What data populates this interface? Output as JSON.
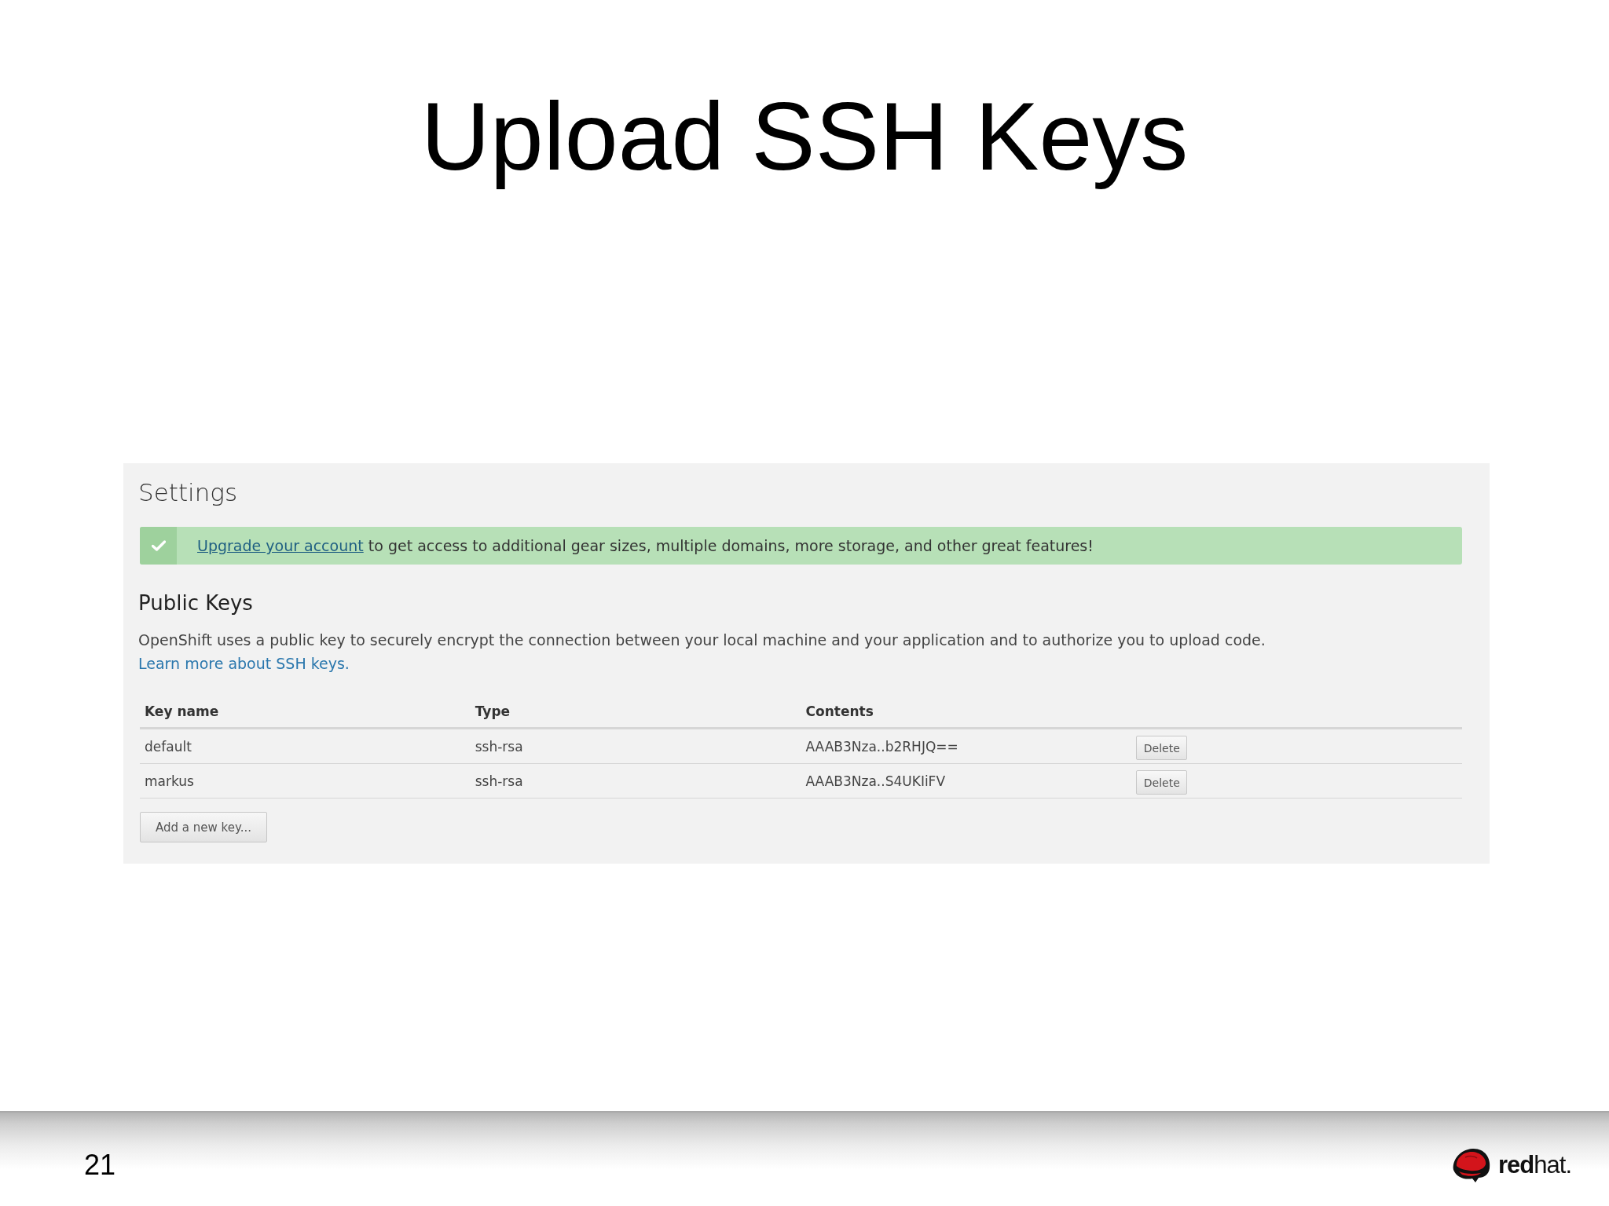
{
  "slide": {
    "title": "Upload SSH Keys"
  },
  "settings": {
    "title": "Settings",
    "alert": {
      "link": "Upgrade your account",
      "text": "to get access to additional gear sizes, multiple domains, more storage, and other great features!"
    },
    "public_keys": {
      "heading": "Public Keys",
      "description": "OpenShift uses a public key to securely encrypt the connection between your local machine and your application and to authorize you to upload code.",
      "link": "Learn more about SSH keys."
    },
    "table": {
      "columns": [
        "Key name",
        "Type",
        "Contents"
      ],
      "rows": [
        {
          "key_name": "default",
          "type": "ssh-rsa",
          "contents": "AAAB3Nza..b2RHJQ==",
          "action": "Delete"
        },
        {
          "key_name": "markus",
          "type": "ssh-rsa",
          "contents": "AAAB3Nza..S4UKIiFV",
          "action": "Delete"
        }
      ]
    },
    "add_button": "Add a new key..."
  },
  "footer": {
    "page_number": "21",
    "logo": "**red**hat."
  }
}
